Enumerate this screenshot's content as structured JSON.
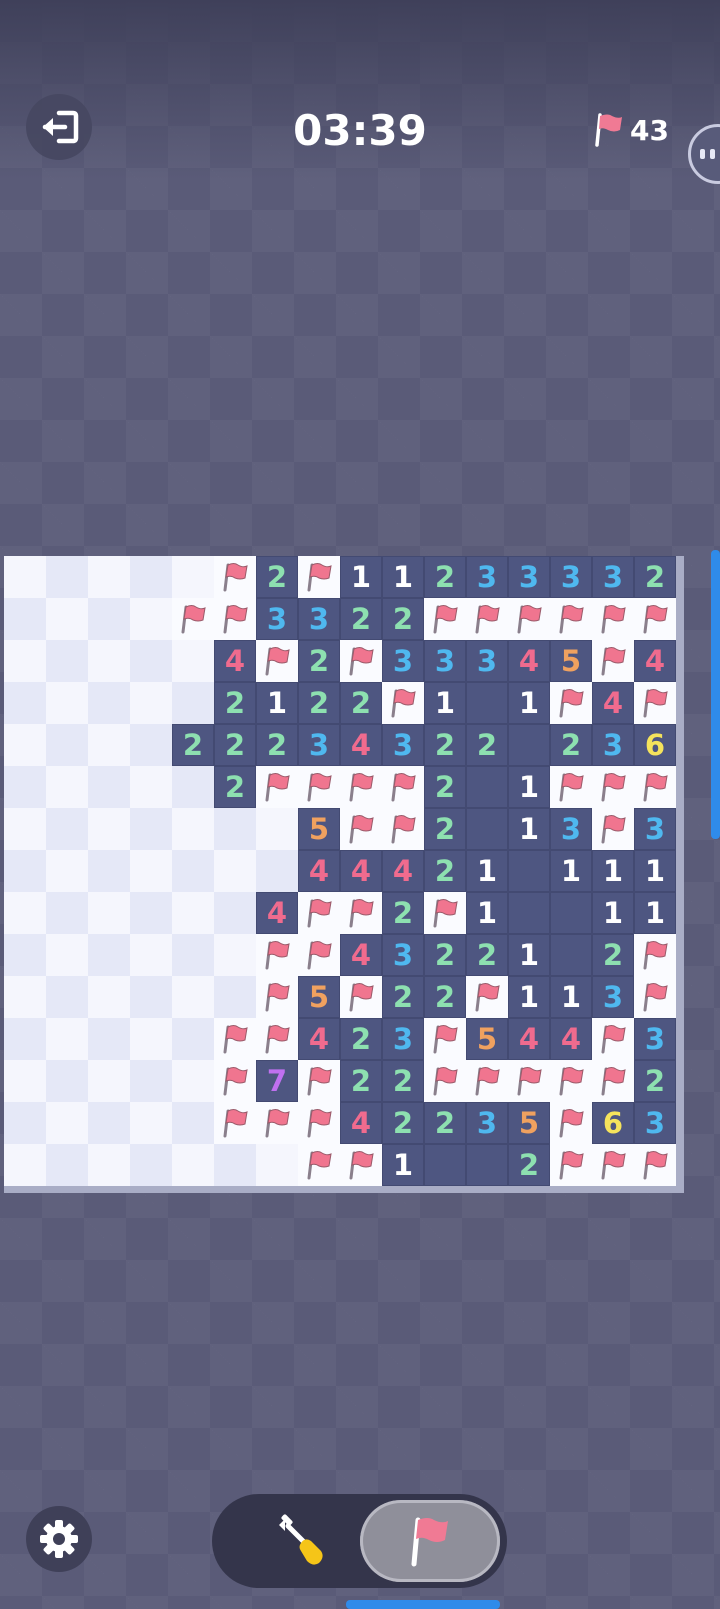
{
  "header": {
    "timer": "03:39",
    "flags_remaining": "43",
    "exit_icon": "exit-icon",
    "flag_icon": "flag-icon",
    "peek_icon": "peek-handle-icon"
  },
  "board": {
    "rows": 15,
    "cols": 16,
    "legend": "H=hidden, F=flagged, .=revealed empty, digit=revealed number",
    "grid": [
      "HHHHHF2F11233332",
      "HHHHFF3322FFFFFF",
      "HHHHH4F2F33345F4",
      "HHHHH2122F1.1F4F",
      "HHHH22234322.236",
      "HHHHH2FFFF2.1FFF",
      "HHHHHHH5FF2.13F3",
      "HHHHHHH44421.111",
      "HHHHHH4FF2F1..11",
      "HHHHHHFF43221.2F",
      "HHHHHHF5F22F113F",
      "HHHHHFF423F544F3",
      "HHHHHF7F22FFFFF2",
      "HHHHHFFF42235F63",
      "HHHHHHHFF1..2FFF"
    ]
  },
  "colors": {
    "1": "#ffffff",
    "2": "#8de0b0",
    "3": "#4fb8ef",
    "4": "#f06b8e",
    "5": "#f0a15f",
    "6": "#f5e35c",
    "7": "#c070f0",
    "flag": "#f0758f",
    "accent": "#2f8bea"
  },
  "controls": {
    "settings_icon": "gear-icon",
    "dig_icon": "shovel-icon",
    "flag_mode_icon": "flag-icon",
    "active_mode": "flag"
  }
}
